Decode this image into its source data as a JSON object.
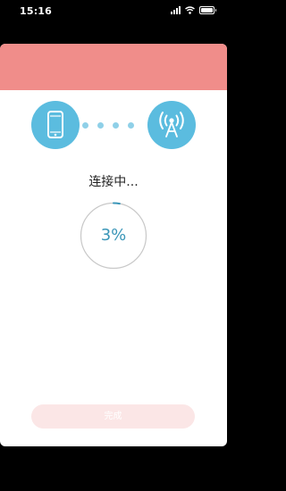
{
  "status_bar": {
    "time": "15:16"
  },
  "header": {
    "color": "#f08d8a"
  },
  "connection": {
    "source_icon": "phone-icon",
    "target_icon": "router-signal-icon",
    "icon_color": "#5bbcdf",
    "status_text": "连接中...",
    "progress_percent": 3,
    "progress_text": "3%"
  },
  "footer": {
    "done_label": "完成"
  }
}
